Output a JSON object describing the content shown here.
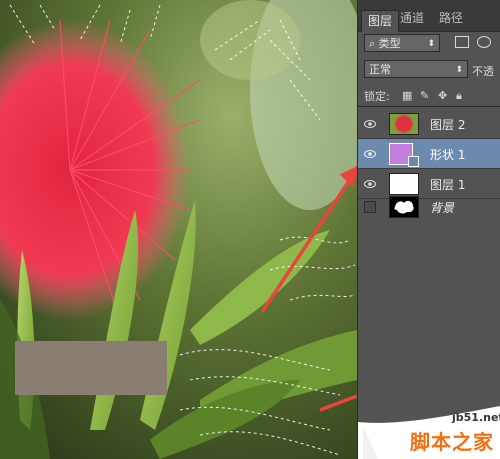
{
  "panel": {
    "tabs": [
      {
        "label": "图层"
      },
      {
        "label": "通道"
      },
      {
        "label": "路径"
      }
    ],
    "filter": {
      "kind_label": "类型"
    },
    "blend": {
      "mode_label": "正常",
      "opacity_label": "不透"
    },
    "lock": {
      "label": "锁定:"
    },
    "layers": [
      {
        "name": "图层 2",
        "visible": true,
        "selected": false
      },
      {
        "name": "形状 1",
        "visible": true,
        "selected": true
      },
      {
        "name": "图层 1",
        "visible": true,
        "selected": false
      },
      {
        "name": "背景",
        "visible": false,
        "selected": false
      }
    ]
  },
  "watermark": {
    "url": "jb51.net",
    "text": "脚本之家"
  },
  "colors": {
    "arrow": "#e8453c",
    "selected_layer": "#6c89ae",
    "shape_fill": "#c27fe0"
  }
}
